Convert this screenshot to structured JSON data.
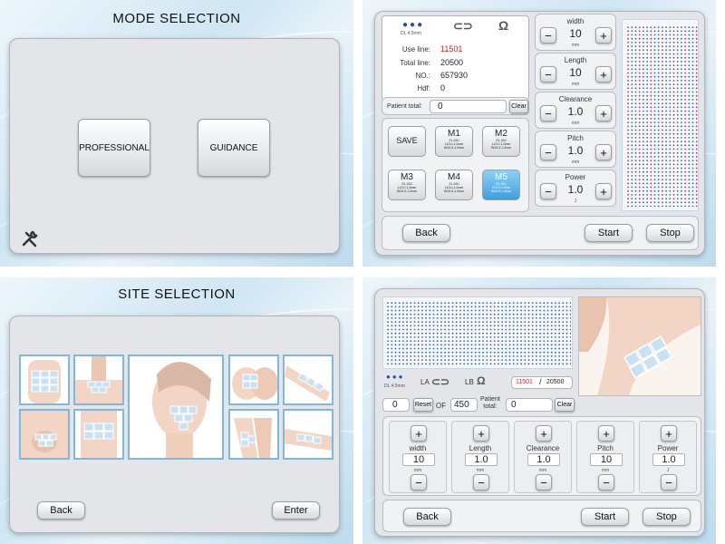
{
  "mode_screen": {
    "title": "MODE SELECTION",
    "professional": "PROFESSIONAL",
    "guidance": "GUIDANCE"
  },
  "pro_screen": {
    "handpiece": {
      "dl": "DL 4.5mm"
    },
    "stats": [
      {
        "label": "Use line:",
        "value": "11501"
      },
      {
        "label": "Total line:",
        "value": "20500"
      },
      {
        "label": "NO.:",
        "value": "657930"
      },
      {
        "label": "Hdf:",
        "value": "0"
      }
    ],
    "patient_label": "Patient total:",
    "patient_value": "0",
    "clear": "Clear",
    "save": "SAVE",
    "memory": [
      {
        "name": "M1",
        "lines": [
          "E1.00J",
          "L10.0-1.0mm",
          "W10.0-1.0mm"
        ]
      },
      {
        "name": "M2",
        "lines": [
          "E1.00J",
          "L10.0-1.0mm",
          "W10.0-1.0mm"
        ]
      },
      {
        "name": "M3",
        "lines": [
          "E1.00J",
          "L10.0-1.0mm",
          "W10.0-1.0mm"
        ]
      },
      {
        "name": "M4",
        "lines": [
          "E1.00J",
          "L10.0-1.0mm",
          "W10.0-1.0mm"
        ]
      },
      {
        "name": "M5",
        "lines": [
          "E1.00J",
          "L10.0-1.0mm",
          "W10.0-1.0mm"
        ]
      }
    ],
    "params": [
      {
        "label": "width",
        "value": "10",
        "unit": "mm"
      },
      {
        "label": "Length",
        "value": "10",
        "unit": "mm"
      },
      {
        "label": "Clearance",
        "value": "1.0",
        "unit": "mm"
      },
      {
        "label": "Pitch",
        "value": "1.0",
        "unit": "mm"
      },
      {
        "label": "Power",
        "value": "1.0",
        "unit": "J"
      }
    ],
    "back": "Back",
    "start": "Start",
    "stop": "Stop"
  },
  "site_screen": {
    "title": "SITE SELECTION",
    "back": "Back",
    "enter": "Enter"
  },
  "guide_screen": {
    "dl": "DL 4.5mm",
    "la": "LA",
    "lb": "LB",
    "use": "11501",
    "slash": "/",
    "total": "20500",
    "count": "0",
    "reset": "Reset",
    "of": "OF",
    "of_value": "450",
    "patient_label_1": "Patient",
    "patient_label_2": "total:",
    "patient_value": "0",
    "clear": "Clear",
    "params": [
      {
        "label": "width",
        "value": "10",
        "unit": "mm"
      },
      {
        "label": "Length",
        "value": "1.0",
        "unit": "mm"
      },
      {
        "label": "Clearance",
        "value": "1.0",
        "unit": "mm"
      },
      {
        "label": "Pitch",
        "value": "10",
        "unit": "mm"
      },
      {
        "label": "Power",
        "value": "1.0",
        "unit": "J"
      }
    ],
    "back": "Back",
    "start": "Start",
    "stop": "Stop"
  },
  "glyphs": {
    "plus": "+",
    "minus": "−",
    "link": "⊂⊃",
    "magnet": "Ω"
  },
  "colors": {
    "accent": "#3d9fdd",
    "red_value": "#d62020",
    "dot_blue": "#3a5fb0",
    "dot_red": "#c0304a"
  }
}
